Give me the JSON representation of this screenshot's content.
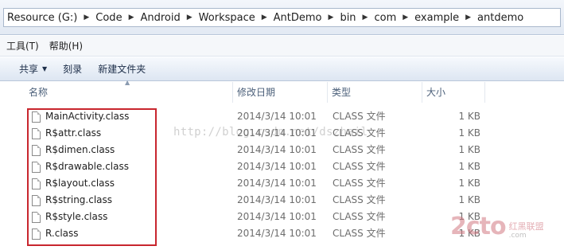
{
  "address": {
    "crumbs": [
      "Resource (G:)",
      "Code",
      "Android",
      "Workspace",
      "AntDemo",
      "bin",
      "com",
      "example",
      "antdemo"
    ]
  },
  "menu": {
    "items": [
      "工具(T)",
      "帮助(H)"
    ]
  },
  "commands": {
    "share": "共享",
    "burn": "刻录",
    "new_folder": "新建文件夹"
  },
  "columns": {
    "name": "名称",
    "date": "修改日期",
    "type": "类型",
    "size": "大小"
  },
  "files": [
    {
      "name": "MainActivity.class",
      "date": "2014/3/14 10:01",
      "type": "CLASS 文件",
      "size": "1 KB"
    },
    {
      "name": "R$attr.class",
      "date": "2014/3/14 10:01",
      "type": "CLASS 文件",
      "size": "1 KB"
    },
    {
      "name": "R$dimen.class",
      "date": "2014/3/14 10:01",
      "type": "CLASS 文件",
      "size": "1 KB"
    },
    {
      "name": "R$drawable.class",
      "date": "2014/3/14 10:01",
      "type": "CLASS 文件",
      "size": "1 KB"
    },
    {
      "name": "R$layout.class",
      "date": "2014/3/14 10:01",
      "type": "CLASS 文件",
      "size": "1 KB"
    },
    {
      "name": "R$string.class",
      "date": "2014/3/14 10:01",
      "type": "CLASS 文件",
      "size": "1 KB"
    },
    {
      "name": "R$style.class",
      "date": "2014/3/14 10:01",
      "type": "CLASS 文件",
      "size": "1 KB"
    },
    {
      "name": "R.class",
      "date": "2014/3/14 10:01",
      "type": "CLASS 文件",
      "size": "1 KB"
    }
  ],
  "watermark": {
    "url": "http://blog.csdn.net/dszhail",
    "logo": "2cto",
    "logo_cn": "红黑联盟",
    "logo_en": ".com"
  },
  "colors": {
    "highlight": "#c8262e"
  }
}
